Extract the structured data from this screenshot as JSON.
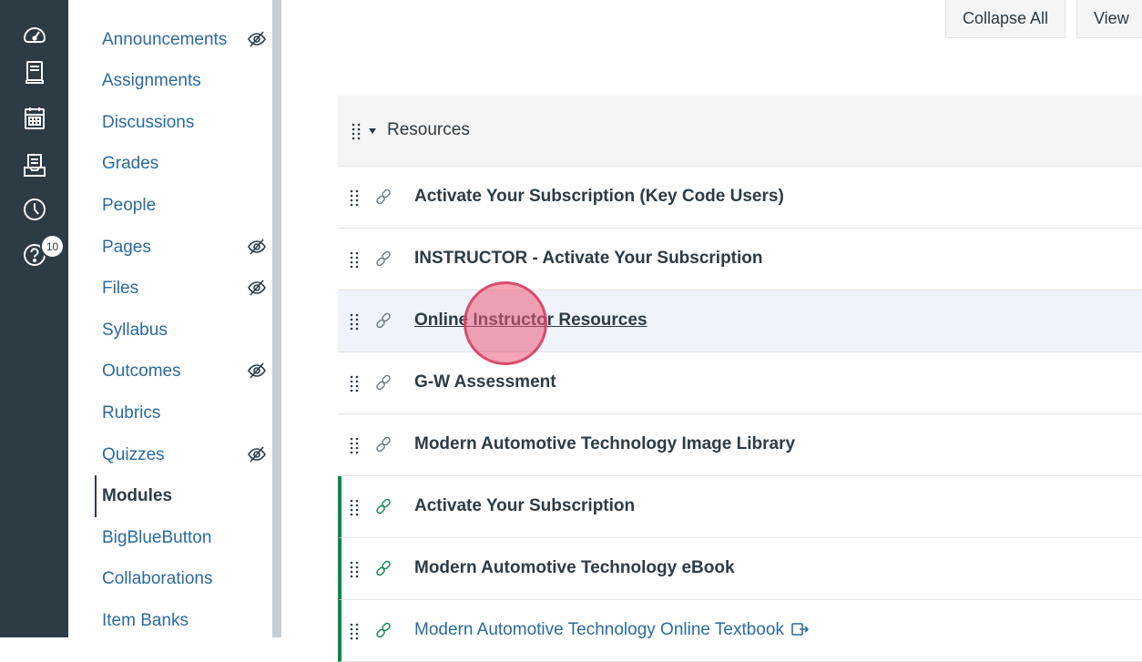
{
  "rail": {
    "help_badge": "10"
  },
  "course_nav": {
    "items": [
      {
        "label": "Announcements",
        "hidden": true
      },
      {
        "label": "Assignments",
        "hidden": false
      },
      {
        "label": "Discussions",
        "hidden": false
      },
      {
        "label": "Grades",
        "hidden": false
      },
      {
        "label": "People",
        "hidden": false
      },
      {
        "label": "Pages",
        "hidden": true
      },
      {
        "label": "Files",
        "hidden": true
      },
      {
        "label": "Syllabus",
        "hidden": false
      },
      {
        "label": "Outcomes",
        "hidden": true
      },
      {
        "label": "Rubrics",
        "hidden": false
      },
      {
        "label": "Quizzes",
        "hidden": true
      },
      {
        "label": "Modules",
        "hidden": false,
        "active": true
      },
      {
        "label": "BigBlueButton",
        "hidden": false
      },
      {
        "label": "Collaborations",
        "hidden": false
      },
      {
        "label": "Item Banks",
        "hidden": false
      }
    ]
  },
  "toolbar": {
    "collapse_all": "Collapse All",
    "view": "View"
  },
  "module": {
    "title": "Resources",
    "items": [
      {
        "title": "Activate Your Subscription (Key Code Users)",
        "published": false
      },
      {
        "title": "INSTRUCTOR - Activate Your Subscription",
        "published": false
      },
      {
        "title": "Online Instructor Resources",
        "published": false,
        "hover": true
      },
      {
        "title": "G-W Assessment",
        "published": false
      },
      {
        "title": "Modern Automotive Technology Image Library",
        "published": false
      },
      {
        "title": "Activate Your Subscription",
        "published": true
      },
      {
        "title": "Modern Automotive Technology eBook",
        "published": true
      },
      {
        "title": "Modern Automotive Technology Online Textbook",
        "published": true,
        "external": true
      }
    ]
  },
  "colors": {
    "rail_bg": "#2d3b45",
    "link_blue": "#2b6a9e",
    "published_green": "#0b874b",
    "hover_row": "#eef4fa"
  }
}
